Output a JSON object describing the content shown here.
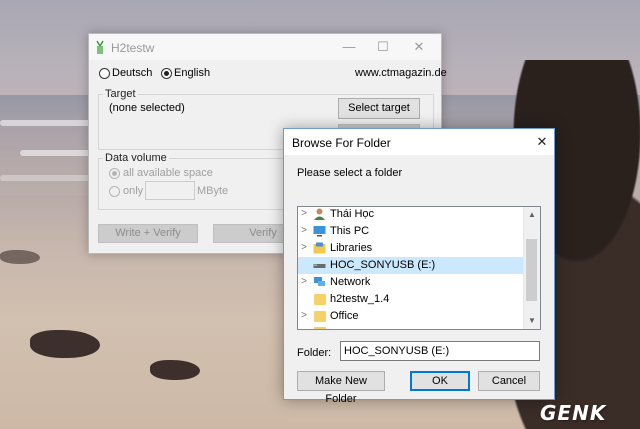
{
  "h2testw": {
    "title": "H2testw",
    "lang_deutsch": "Deutsch",
    "lang_english": "English",
    "website": "www.ctmagazin.de",
    "target_group": "Target",
    "target_value": "(none selected)",
    "select_target": "Select target",
    "data_volume_group": "Data volume",
    "all_space": "all available space",
    "only": "only",
    "mbyte": "MByte",
    "write_verify": "Write + Verify",
    "verify": "Verify"
  },
  "browse": {
    "title": "Browse For Folder",
    "instruction": "Please select a folder",
    "tree": [
      {
        "label": "Thái Học",
        "icon": "user-icon",
        "expandable": true
      },
      {
        "label": "This PC",
        "icon": "computer-icon",
        "expandable": true
      },
      {
        "label": "Libraries",
        "icon": "libraries-icon",
        "expandable": true
      },
      {
        "label": "HOC_SONYUSB (E:)",
        "icon": "usb-drive-icon",
        "expandable": false,
        "selected": true
      },
      {
        "label": "Network",
        "icon": "network-icon",
        "expandable": true
      },
      {
        "label": "h2testw_1.4",
        "icon": "folder-icon",
        "expandable": false
      },
      {
        "label": "Office",
        "icon": "folder-icon",
        "expandable": true
      }
    ],
    "folder_label": "Folder:",
    "folder_value": "HOC_SONYUSB (E:)",
    "new_folder": "Make New Folder",
    "ok": "OK",
    "cancel": "Cancel"
  },
  "watermark": "GENK",
  "colors": {
    "selection": "#cce8ff",
    "accent": "#0078d7"
  }
}
